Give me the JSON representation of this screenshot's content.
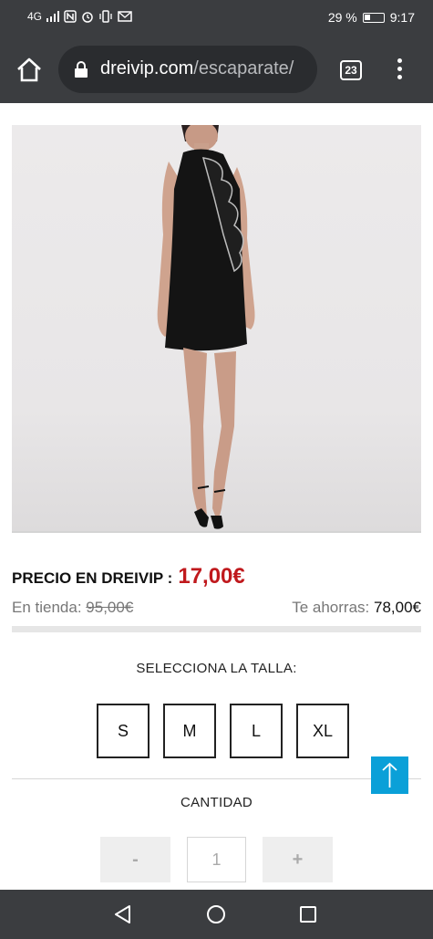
{
  "status_bar": {
    "network": "4G",
    "battery": "29 %",
    "time": "9:17"
  },
  "browser": {
    "url_domain": "dreivip.com",
    "url_path": "/escaparate/",
    "tab_count": "23"
  },
  "product": {
    "price_label": "PRECIO EN DREIVIP :",
    "price_value": "17,00€",
    "store_label": "En tienda:",
    "store_price": "95,00€",
    "savings_label": "Te ahorras:",
    "savings_value": "78,00€"
  },
  "sizes": {
    "title": "SELECCIONA LA TALLA:",
    "options": [
      "S",
      "M",
      "L",
      "XL"
    ]
  },
  "quantity": {
    "title": "CANTIDAD",
    "minus": "-",
    "value": "1",
    "plus": "+"
  },
  "colors": {
    "bars": "#3b3d40",
    "price_red": "#c0191d",
    "scroll_top": "#0aa0d8"
  }
}
